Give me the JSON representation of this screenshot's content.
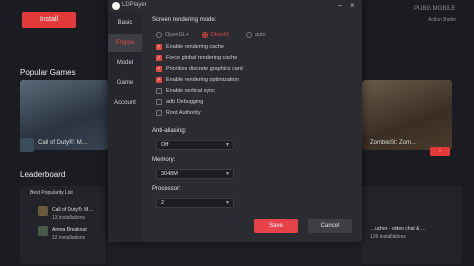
{
  "background": {
    "install_label": "Install",
    "pubg_label": "PUBG MOBILE",
    "pubg_sub": "Action Battle",
    "popular_games": "Popular Games",
    "game1": "Call of Duty®: M…",
    "game2": "ZombieSt: Zom…",
    "leaderboard": "Leaderboard",
    "best_popularity": "Best Popularity List",
    "list_items": [
      "Call of Duty®: M…",
      "Arena Breakout",
      "…"
    ],
    "installs": [
      "13 installations",
      "12 installations"
    ],
    "right_items": [
      "…ucher - video chat & …",
      "126 installations"
    ]
  },
  "dialog": {
    "app_title": "LDPlayer",
    "sidebar": [
      "Basic",
      "Engine",
      "Model",
      "Game",
      "Account"
    ],
    "active_tab": "Engine",
    "screen_mode_label": "Screen rendering mode:",
    "modes": [
      "OpenGL+",
      "DirectX",
      "auto"
    ],
    "selected_mode": "DirectX",
    "checkboxes": [
      {
        "label": "Enable rendering cache",
        "checked": true
      },
      {
        "label": "Force global rendering cache",
        "checked": true
      },
      {
        "label": "Prioritize discrete graphics card",
        "checked": true
      },
      {
        "label": "Enable rendering optimization",
        "checked": true
      },
      {
        "label": "Enable vertical sync",
        "checked": false
      },
      {
        "label": "adb Debugging",
        "checked": false
      },
      {
        "label": "Root Authority",
        "checked": false
      }
    ],
    "antialias_label": "Anti-aliasing:",
    "antialias_value": "Off",
    "memory_label": "Memory:",
    "memory_value": "3048M",
    "processor_label": "Processor:",
    "processor_value": "2",
    "save_label": "Save",
    "cancel_label": "Cancel"
  },
  "colors": {
    "accent": "#e2483b",
    "save": "#e6424a",
    "dialog_bg": "#2a2c31"
  }
}
